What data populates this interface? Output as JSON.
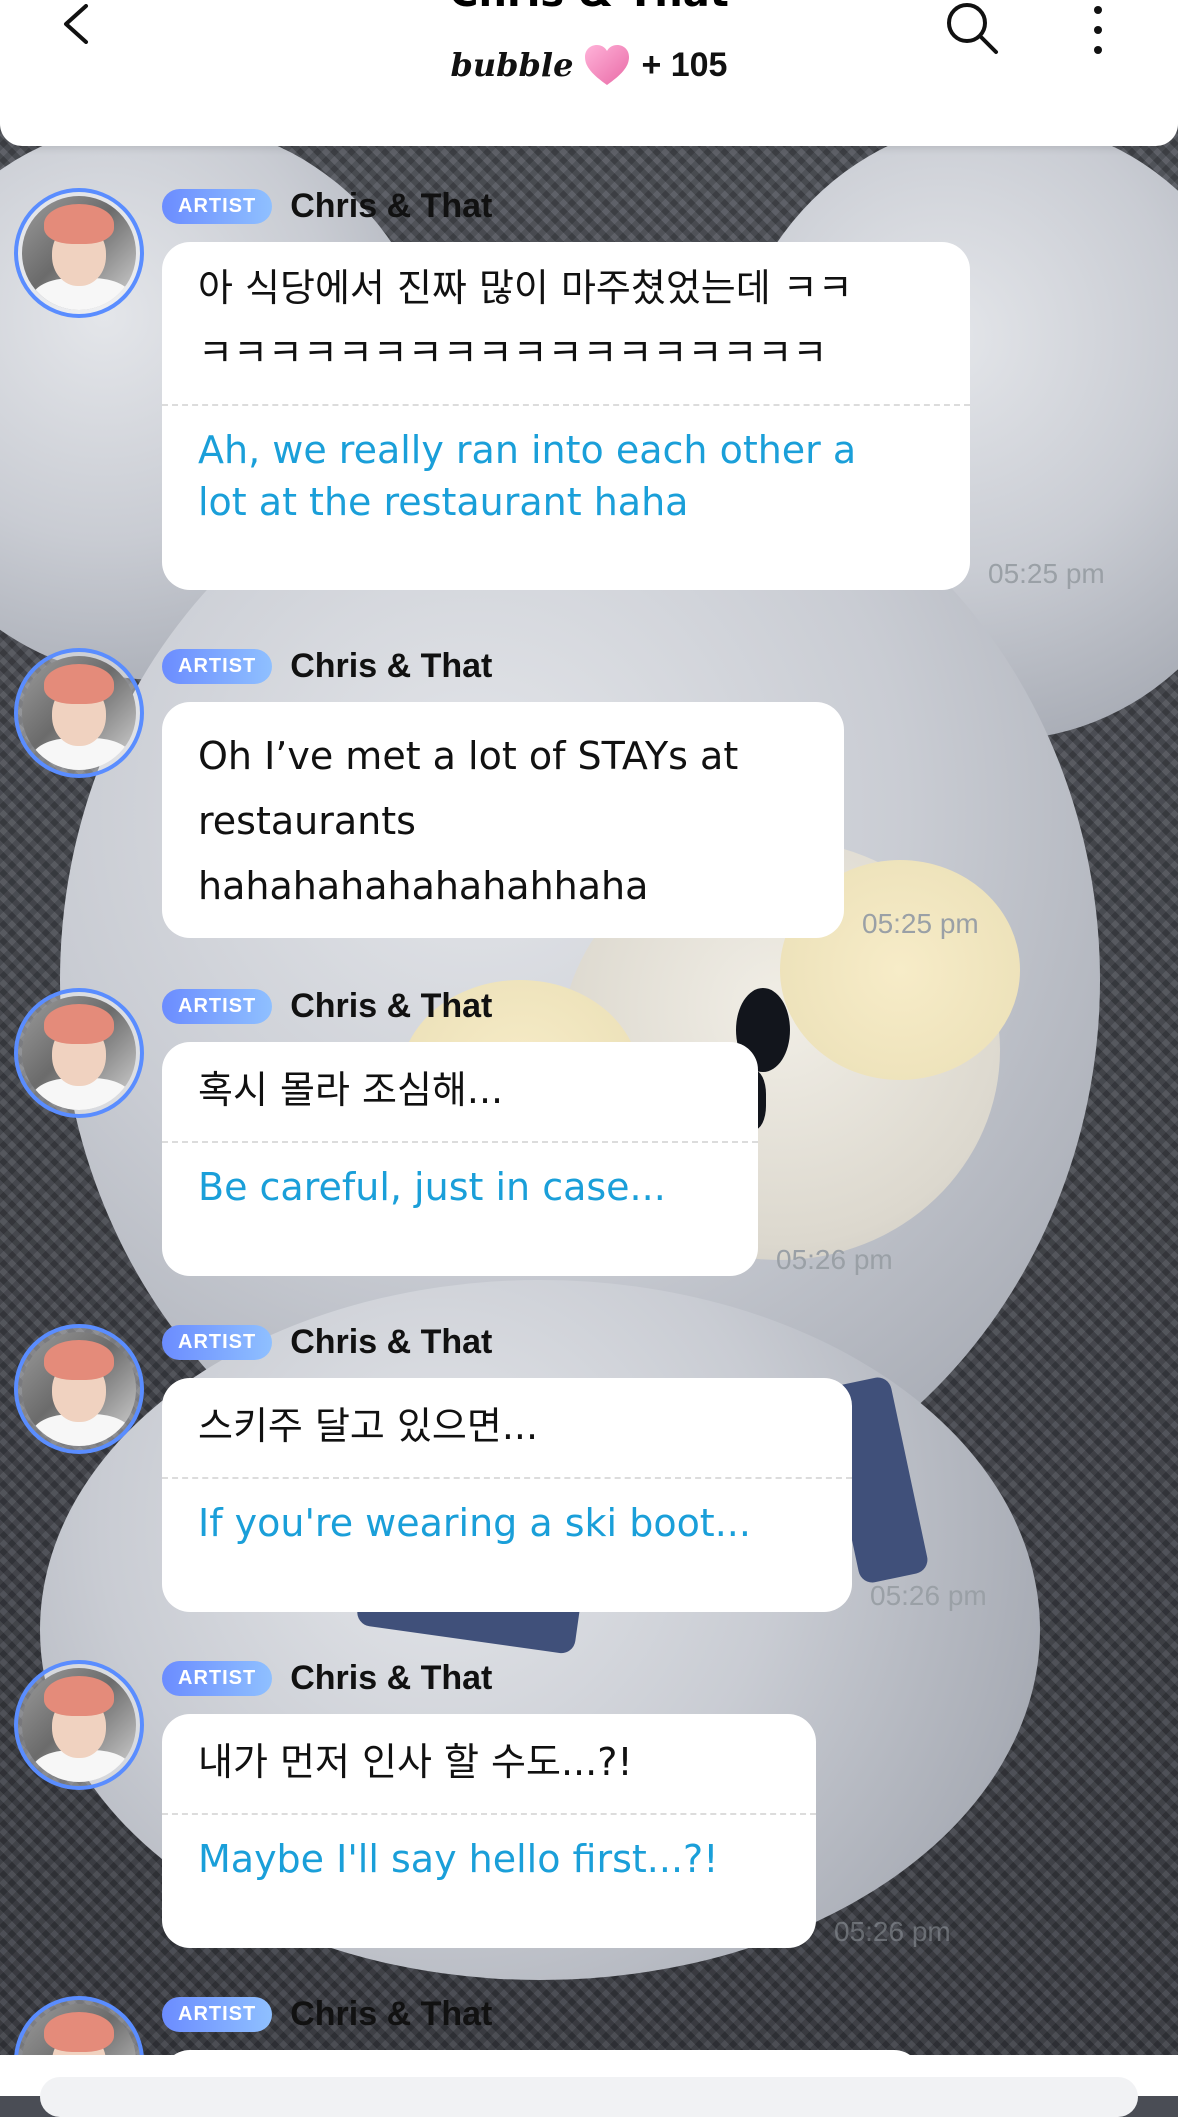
{
  "header": {
    "title": "Chris & That",
    "bubble_logo": "bubble",
    "bubble_count": "+ 105"
  },
  "messages": [
    {
      "badge": "ARTIST",
      "sender": "Chris & That",
      "original_line1": "아 식당에서 진짜 많이 마주쳤었는데 ㅋㅋ",
      "original_line2": "ㅋㅋㅋㅋㅋㅋㅋㅋㅋㅋㅋㅋㅋㅋㅋㅋㅋㅋ",
      "translation_line1": "Ah, we really ran into each other a",
      "translation_line2": "lot at the restaurant haha",
      "time": "05:25 pm"
    },
    {
      "badge": "ARTIST",
      "sender": "Chris & That",
      "original_line1": "Oh I’ve met a lot of STAYs at",
      "original_line2": "restaurants",
      "original_line3": "hahahahahahahahhaha",
      "time": "05:25 pm"
    },
    {
      "badge": "ARTIST",
      "sender": "Chris & That",
      "original": "혹시 몰라 조심해...",
      "translation": "Be careful, just in case...",
      "time": "05:26 pm"
    },
    {
      "badge": "ARTIST",
      "sender": "Chris & That",
      "original": "스키주 달고 있으면...",
      "translation": "If you're wearing a ski boot...",
      "time": "05:26 pm"
    },
    {
      "badge": "ARTIST",
      "sender": "Chris & That",
      "original": "내가 먼저 인사 할 수도...?!",
      "translation": "Maybe I'll say hello first...?!",
      "time": "05:26 pm"
    },
    {
      "badge": "ARTIST",
      "sender": "Chris & That"
    }
  ],
  "colors": {
    "header_bg": "#ffffff",
    "bubble_bg": "#ffffff",
    "translation_text": "#1a9fd9",
    "artist_badge": "#6b8cff",
    "avatar_ring": "#5a8dff",
    "time_text": "#9aa0a6"
  },
  "icons": [
    "back-arrow-icon",
    "search-icon",
    "more-vertical-icon",
    "heart-icon"
  ]
}
